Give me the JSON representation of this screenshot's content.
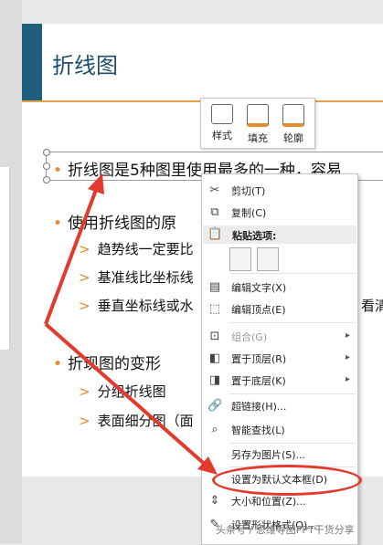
{
  "slide": {
    "title": "折线图",
    "bullet1": "折线图是5种图里使用最多的一种，容易",
    "bullet2": "使用折线图的原",
    "sub2a": "趋势线一定要比",
    "sub2b": "基准线比坐标线",
    "sub2c": "垂直坐标线或水",
    "sub2c_tail": "看清",
    "bullet3": "折现图的变形",
    "sub3a": "分组折线图",
    "sub3b": "表面细分图（面"
  },
  "mini_toolbar": {
    "style_label": "样式",
    "fill_label": "填充",
    "outline_label": "轮廓"
  },
  "context_menu": {
    "cut": "剪切(T)",
    "copy": "复制(C)",
    "paste_options": "粘贴选项:",
    "edit_text": "编辑文字(X)",
    "edit_points": "编辑顶点(E)",
    "group": "组合(G)",
    "bring_front": "置于顶层(R)",
    "send_back": "置于底层(K)",
    "hyperlink": "超链接(H)...",
    "smart_lookup": "智能查找(L)",
    "save_as_picture": "另存为图片(S)...",
    "set_default_textbox": "设置为默认文本框(D)",
    "size_position": "大小和位置(Z)...",
    "format_shape": "设置形状格式(O)..."
  },
  "watermark": "头条号 / 思维导图PPT干货分享",
  "colors": {
    "accent_orange": "#e58b2c",
    "title_bar": "#1f5f7d",
    "highlight_red": "#e33a2e"
  }
}
